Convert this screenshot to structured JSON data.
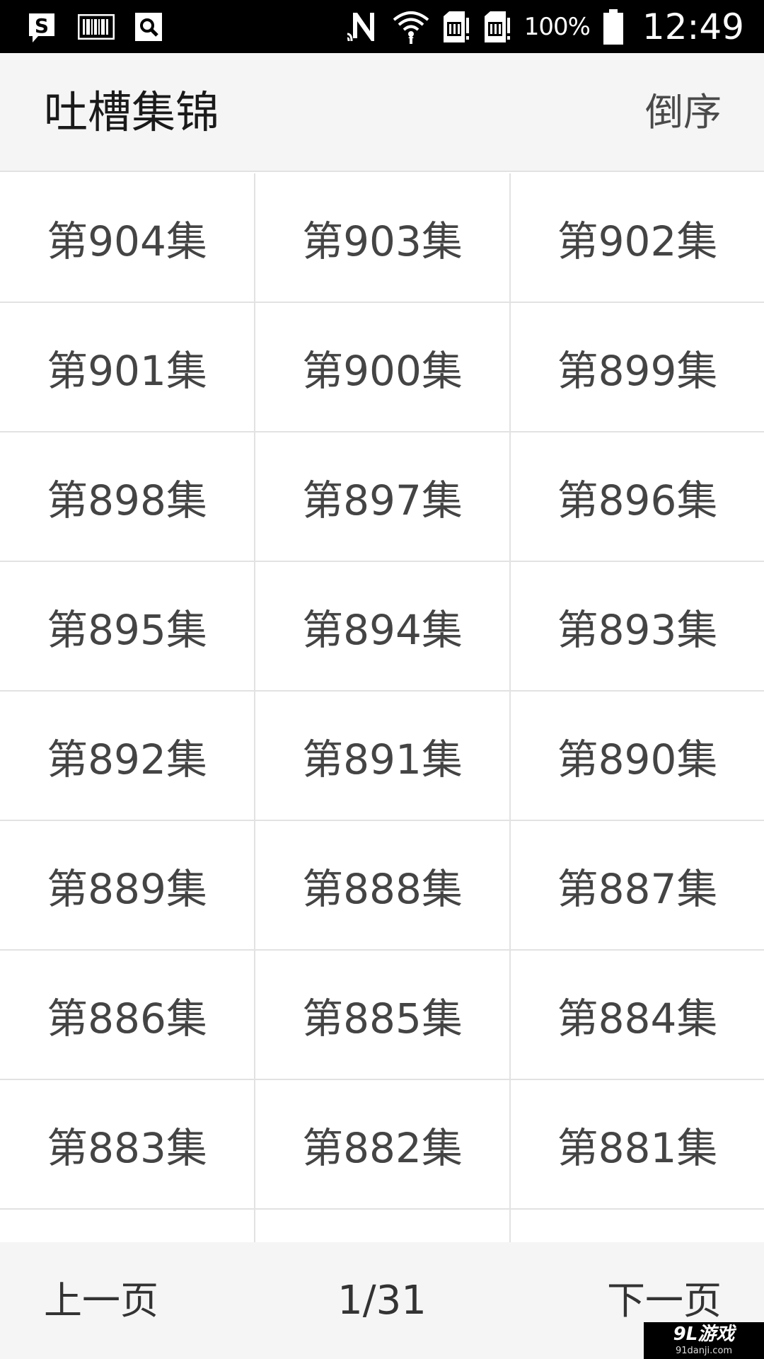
{
  "status_bar": {
    "left_icons": [
      "s-notification-icon",
      "barcode-icon",
      "search-notification-icon"
    ],
    "right_icons": [
      "nfc-icon",
      "wifi-icon",
      "sim1-icon",
      "sim2-icon",
      "battery-icon"
    ],
    "battery_percent": "100%",
    "time": "12:49"
  },
  "header": {
    "title": "吐槽集锦",
    "sort_label": "倒序"
  },
  "episodes": [
    "第904集",
    "第903集",
    "第902集",
    "第901集",
    "第900集",
    "第899集",
    "第898集",
    "第897集",
    "第896集",
    "第895集",
    "第894集",
    "第893集",
    "第892集",
    "第891集",
    "第890集",
    "第889集",
    "第888集",
    "第887集",
    "第886集",
    "第885集",
    "第884集",
    "第883集",
    "第882集",
    "第881集",
    "",
    "",
    ""
  ],
  "pager": {
    "prev_label": "上一页",
    "page_indicator": "1/31",
    "next_label": "下一页"
  },
  "watermark": {
    "logo": "9L游戏",
    "url": "91danji.com"
  },
  "colors": {
    "status_bar_bg": "#000000",
    "header_bg": "#f5f5f5",
    "grid_line": "#e2e2e2",
    "cell_text": "#444444"
  }
}
